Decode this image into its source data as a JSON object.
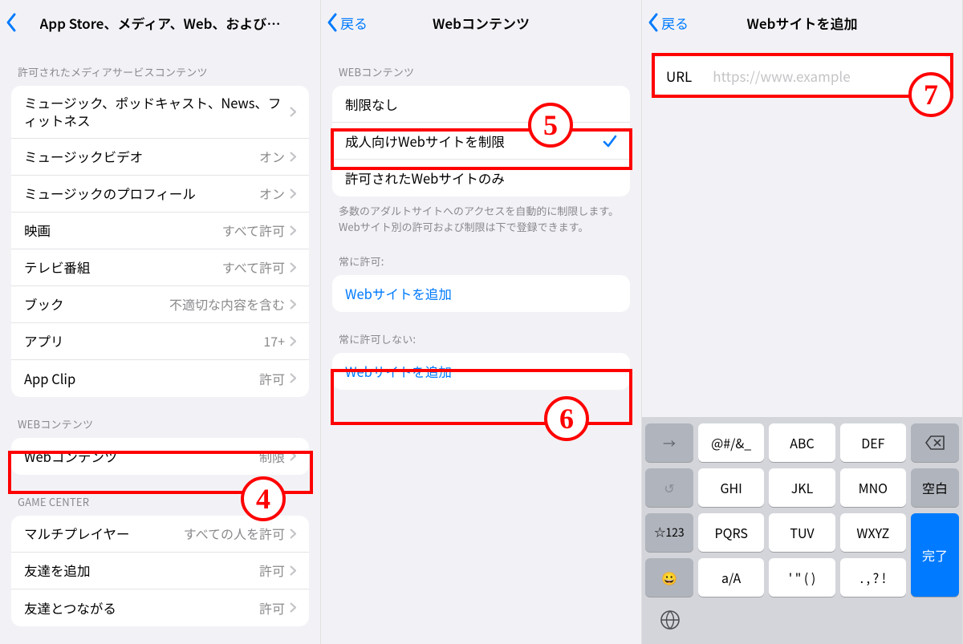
{
  "screen1": {
    "title": "App Store、メディア、Web、およびゲ…",
    "section1_header": "許可されたメディアサービスコンテンツ",
    "rows": {
      "music": "ミュージック、ポッドキャスト、News、フィットネス",
      "music_video": "ミュージックビデオ",
      "music_video_val": "オン",
      "music_profile": "ミュージックのプロフィール",
      "music_profile_val": "オン",
      "movies": "映画",
      "movies_val": "すべて許可",
      "tv": "テレビ番組",
      "tv_val": "すべて許可",
      "books": "ブック",
      "books_val": "不適切な内容を含む",
      "apps": "アプリ",
      "apps_val": "17+",
      "appclip": "App Clip",
      "appclip_val": "許可"
    },
    "section2_header": "WEBコンテンツ",
    "web_content": "Webコンテンツ",
    "web_content_val": "制限",
    "section3_header": "GAME CENTER",
    "gc": {
      "multiplayer": "マルチプレイヤー",
      "multiplayer_val": "すべての人を許可",
      "addfriend": "友達を追加",
      "addfriend_val": "許可",
      "connect": "友達とつながる",
      "connect_val": "許可"
    }
  },
  "screen2": {
    "back": "戻る",
    "title": "Webコンテンツ",
    "section_header": "WEBコンテンツ",
    "options": {
      "none": "制限なし",
      "adult": "成人向けWebサイトを制限",
      "allowed": "許可されたWebサイトのみ"
    },
    "footer": "多数のアダルトサイトへのアクセスを自動的に制限します。Webサイト別の許可および制限は下で登録できます。",
    "always_allow_header": "常に許可:",
    "always_deny_header": "常に許可しない:",
    "add_website": "Webサイトを追加"
  },
  "screen3": {
    "back": "戻る",
    "title": "Webサイトを追加",
    "url_label": "URL",
    "url_placeholder": "https://www.example",
    "keys": {
      "r1": [
        "@#/&_",
        "ABC",
        "DEF"
      ],
      "r2": [
        "GHI",
        "JKL",
        "MNO"
      ],
      "space": "空白",
      "r3": [
        "PQRS",
        "TUV",
        "WXYZ"
      ],
      "star": "☆123",
      "done": "完了",
      "r4": [
        "a/A",
        "' \" ( )",
        ". , ? !"
      ]
    }
  },
  "badges": {
    "b4": "4",
    "b5": "5",
    "b6": "6",
    "b7": "7"
  }
}
